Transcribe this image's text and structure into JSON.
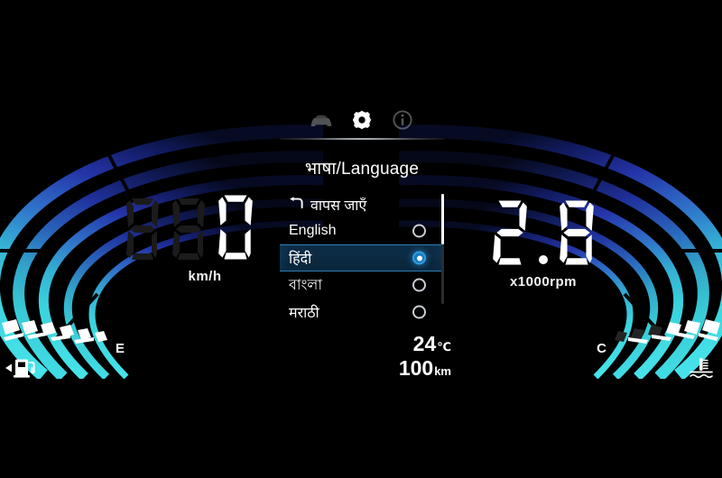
{
  "cluster": {
    "background_color": "#000000",
    "accent_color": "#2f9fe0",
    "arc_color_top": "#2b3fb4",
    "arc_color_bottom": "#35d6e0"
  },
  "speedometer": {
    "ghost_digits": "88",
    "value": "0",
    "unit": "km/h"
  },
  "tachometer": {
    "value": "2.8",
    "unit": "x1000rpm"
  },
  "menu": {
    "title": "भाषा/Language",
    "tabs": [
      {
        "icon": "car-icon",
        "state": "inactive"
      },
      {
        "icon": "gear-icon",
        "state": "active"
      },
      {
        "icon": "info-icon",
        "state": "inactive"
      }
    ],
    "back_item": {
      "icon": "back-arrow-icon",
      "label": "वापस जाएँ"
    },
    "options": [
      {
        "label": "English",
        "selected": false
      },
      {
        "label": "हिंदी",
        "selected": true
      },
      {
        "label": "বাংলা",
        "selected": false
      },
      {
        "label": "मराठी",
        "selected": false
      }
    ],
    "scrollbar": {
      "thumb_position": "top"
    }
  },
  "info": {
    "temperature_value": "24",
    "temperature_unit": "℃",
    "odometer_value": "100",
    "odometer_unit": "km"
  },
  "fuel_gauge": {
    "label": "E",
    "icon": "fuel-pump-icon",
    "level_segments": 6,
    "filled_segments": 6
  },
  "temp_gauge": {
    "label": "C",
    "icon": "coolant-temp-icon",
    "level_segments": 6,
    "filled_segments": 3
  }
}
